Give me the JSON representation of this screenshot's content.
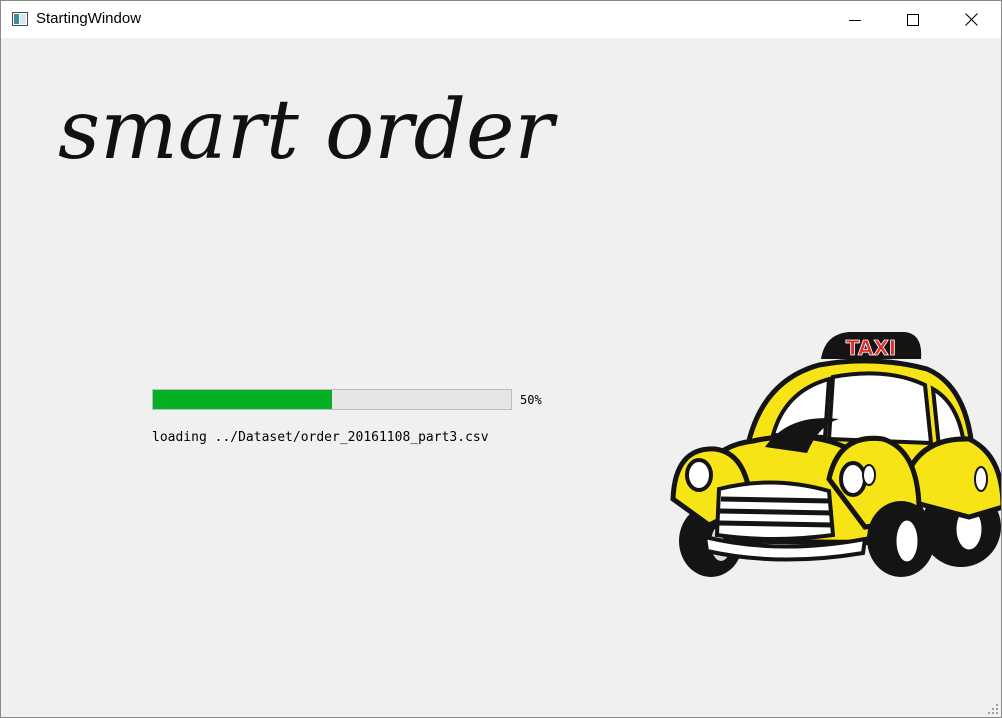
{
  "window": {
    "title": "StartingWindow",
    "controls": {
      "minimize_icon": "minimize-icon",
      "maximize_icon": "maximize-icon",
      "close_icon": "close-icon"
    }
  },
  "logo": {
    "text": "smart order"
  },
  "progress": {
    "value": 50,
    "label": "50%",
    "fill_color": "#06b025"
  },
  "status": {
    "text": "loading ../Dataset/order_20161108_part3.csv"
  },
  "illustration": {
    "sign_text": "TAXI",
    "body_color": "#f7e417",
    "sign_color": "#e02b2b"
  }
}
